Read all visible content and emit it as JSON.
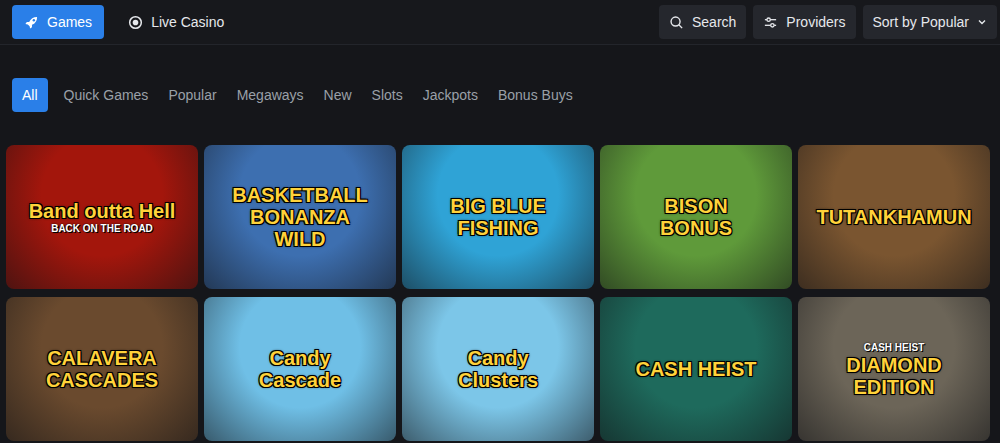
{
  "nav": {
    "tabs": [
      {
        "label": "Games",
        "selected": true
      },
      {
        "label": "Live Casino",
        "selected": false
      }
    ],
    "search": "Search",
    "providers": "Providers",
    "sort": "Sort by Popular"
  },
  "categories": [
    {
      "label": "All",
      "selected": true
    },
    {
      "label": "Quick Games",
      "selected": false
    },
    {
      "label": "Popular",
      "selected": false
    },
    {
      "label": "Megaways",
      "selected": false
    },
    {
      "label": "New",
      "selected": false
    },
    {
      "label": "Slots",
      "selected": false
    },
    {
      "label": "Jackpots",
      "selected": false
    },
    {
      "label": "Bonus Buys",
      "selected": false
    }
  ],
  "games": [
    {
      "lines": [
        {
          "text": "Band outta Hell",
          "kind": "title"
        },
        {
          "text": "BACK ON THE ROAD",
          "kind": "tagline"
        }
      ],
      "color": "#a3160c"
    },
    {
      "lines": [
        {
          "text": "BASKETBALL",
          "kind": "title"
        },
        {
          "text": "BONANZA",
          "kind": "title"
        },
        {
          "text": "WILD",
          "kind": "title"
        }
      ],
      "color": "#3d6fb0"
    },
    {
      "lines": [
        {
          "text": "BIG BLUE",
          "kind": "title"
        },
        {
          "text": "FISHING",
          "kind": "title"
        }
      ],
      "color": "#2fa3d6"
    },
    {
      "lines": [
        {
          "text": "BISON",
          "kind": "title"
        },
        {
          "text": "BONUS",
          "kind": "title"
        }
      ],
      "color": "#5f9a3a"
    },
    {
      "lines": [
        {
          "text": "TUTANKHAMUN",
          "kind": "title"
        }
      ],
      "color": "#7a5530"
    },
    {
      "lines": [
        {
          "text": "CALAVERA CASCADES",
          "kind": "title"
        }
      ],
      "color": "#6a4a2e"
    },
    {
      "lines": [
        {
          "text": "Candy",
          "kind": "title"
        },
        {
          "text": "Cascade",
          "kind": "title"
        }
      ],
      "color": "#6fbfe6"
    },
    {
      "lines": [
        {
          "text": "Candy",
          "kind": "title"
        },
        {
          "text": "Clusters",
          "kind": "title"
        }
      ],
      "color": "#7cc6e8"
    },
    {
      "lines": [
        {
          "text": "CASH HEIST",
          "kind": "title"
        }
      ],
      "color": "#1e6a5c"
    },
    {
      "lines": [
        {
          "text": "CASH HEIST",
          "kind": "tagline"
        },
        {
          "text": "DIAMOND",
          "kind": "title"
        },
        {
          "text": "EDITION",
          "kind": "title"
        }
      ],
      "color": "#6c6558"
    }
  ]
}
